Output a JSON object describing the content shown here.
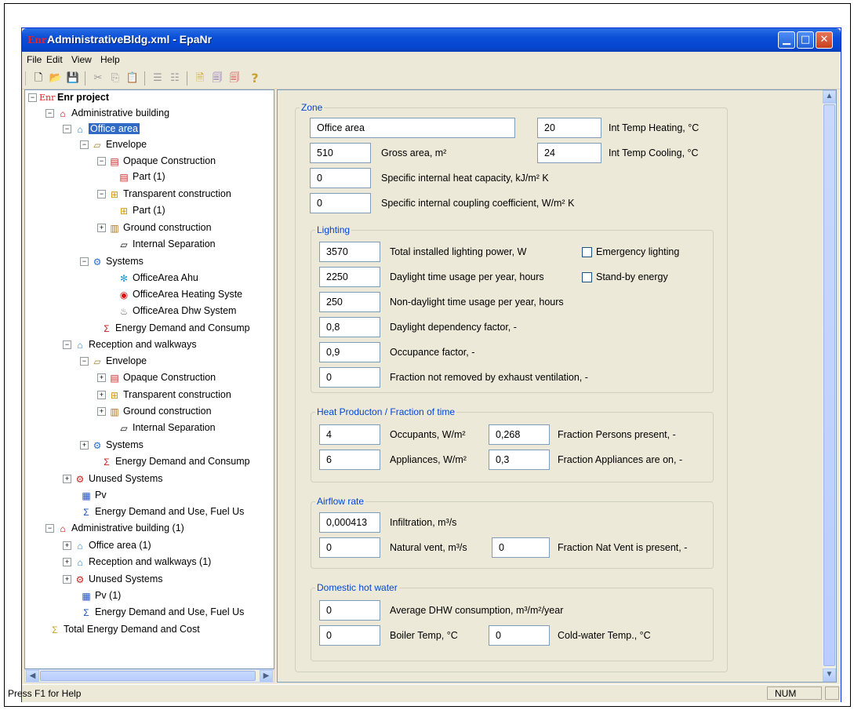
{
  "window": {
    "title": "AdministrativeBldg.xml - EpaNr",
    "app_icon": "Enr"
  },
  "menu": [
    "File",
    "Edit",
    "View",
    "Help"
  ],
  "toolbar": [
    "new-file-icon",
    "open-folder-icon",
    "save-icon",
    "cut-icon",
    "copy-icon",
    "paste-icon",
    "tree-icon",
    "tree-alt-icon",
    "document-icon",
    "doc-export-icon",
    "rbs-export-icon",
    "help-icon"
  ],
  "tree": {
    "root": "Enr project",
    "root_icon": "Enr",
    "b1": "Administrative building",
    "office_area": "Office area",
    "envelope": "Envelope",
    "opaque": "Opaque Construction",
    "part1": "Part (1)",
    "transparent": "Transparent construction",
    "part1b": "Part (1)",
    "ground": "Ground construction",
    "internal_sep": "Internal Separation",
    "systems": "Systems",
    "ahu": "OfficeArea Ahu",
    "heating": "OfficeArea Heating Syste",
    "dhw": "OfficeArea Dhw System",
    "energy1": "Energy Demand and Consump",
    "reception": "Reception and walkways",
    "envelope2": "Envelope",
    "opaque2": "Opaque Construction",
    "transparent2": "Transparent construction",
    "ground2": "Ground construction",
    "internal_sep2": "Internal Separation",
    "systems2": "Systems",
    "energy2": "Energy Demand and Consump",
    "unused": "Unused Systems",
    "pv": "Pv",
    "energy_use": "Energy Demand and Use, Fuel Us",
    "b2": "Administrative building (1)",
    "office_area1": "Office area (1)",
    "reception1": "Reception and walkways (1)",
    "unused1": "Unused Systems",
    "pv1": "Pv (1)",
    "energy_use1": "Energy Demand and Use, Fuel Us",
    "total": "Total Energy Demand and Cost"
  },
  "zone": {
    "title": "Zone",
    "name": "Office area",
    "int_temp_heating": "20",
    "int_temp_heating_label": "Int Temp Heating, °C",
    "gross_area": "510",
    "gross_area_label": "Gross area, m²",
    "int_temp_cooling": "24",
    "int_temp_cooling_label": "Int Temp Cooling, °C",
    "heat_capacity": "0",
    "heat_capacity_label": "Specific internal heat capacity, kJ/m² K",
    "coupling": "0",
    "coupling_label": "Specific internal coupling coefficient, W/m² K"
  },
  "lighting": {
    "title": "Lighting",
    "power": "3570",
    "power_label": "Total installed lighting power, W",
    "emergency_label": "Emergency lighting",
    "emergency_checked": false,
    "daylight_hours": "2250",
    "daylight_hours_label": "Daylight time usage per year, hours",
    "standby_label": "Stand-by energy",
    "standby_checked": false,
    "nondaylight_hours": "250",
    "nondaylight_hours_label": "Non-daylight time usage per year, hours",
    "daylight_factor": "0,8",
    "daylight_factor_label": "Daylight dependency factor, -",
    "occupance": "0,9",
    "occupance_label": "Occupance factor, -",
    "fraction_exhaust": "0",
    "fraction_exhaust_label": "Fraction not removed by exhaust ventilation, -"
  },
  "heat": {
    "title": "Heat Producton / Fraction of time",
    "occupants": "4",
    "occupants_label": "Occupants, W/m²",
    "fraction_persons": "0,268",
    "fraction_persons_label": "Fraction Persons present, -",
    "appliances": "6",
    "appliances_label": "Appliances, W/m²",
    "fraction_appliances": "0,3",
    "fraction_appliances_label": "Fraction Appliances are on, -"
  },
  "airflow": {
    "title": "Airflow rate",
    "infiltration": "0,000413",
    "infiltration_label": "Infiltration, m³/s",
    "natural_vent": "0",
    "natural_vent_label": "Natural vent, m³/s",
    "fraction_nat": "0",
    "fraction_nat_label": "Fraction Nat Vent is present, -"
  },
  "dhw": {
    "title": "Domestic hot water",
    "consumption": "0",
    "consumption_label": "Average DHW consumption, m³/m²/year",
    "boiler": "0",
    "boiler_label": "Boiler Temp, °C",
    "coldwater": "0",
    "coldwater_label": "Cold-water Temp., °C"
  },
  "status": {
    "help": "Press F1 for Help",
    "indicator": "NUM"
  }
}
